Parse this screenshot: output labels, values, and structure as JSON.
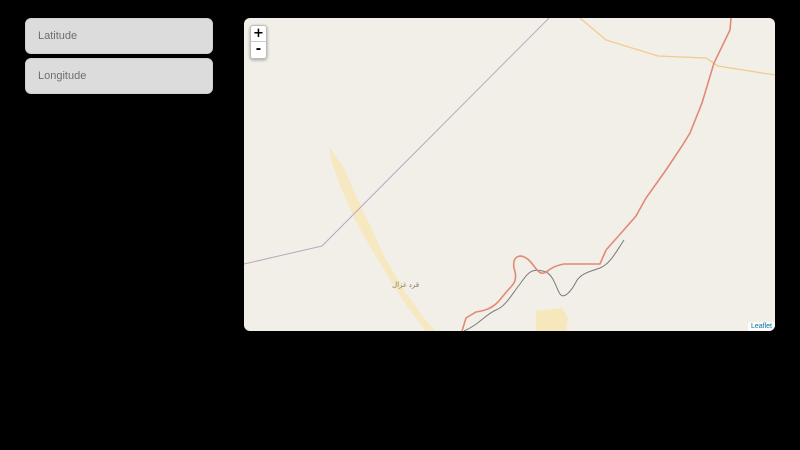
{
  "form": {
    "latitude_placeholder": "Latitude",
    "longitude_placeholder": "Longitude"
  },
  "map": {
    "zoom_in_label": "+",
    "zoom_out_label": "-",
    "place_label": "قرد غزال",
    "attribution": "Leaflet"
  },
  "colors": {
    "page_background": "#000000",
    "map_land": "#f2efe9",
    "border_line": "#b8a8c0",
    "river_border": "#e08a74",
    "road": "#f3c98b",
    "sand": "#f7e6b8",
    "attribution_link": "#0078a8"
  }
}
